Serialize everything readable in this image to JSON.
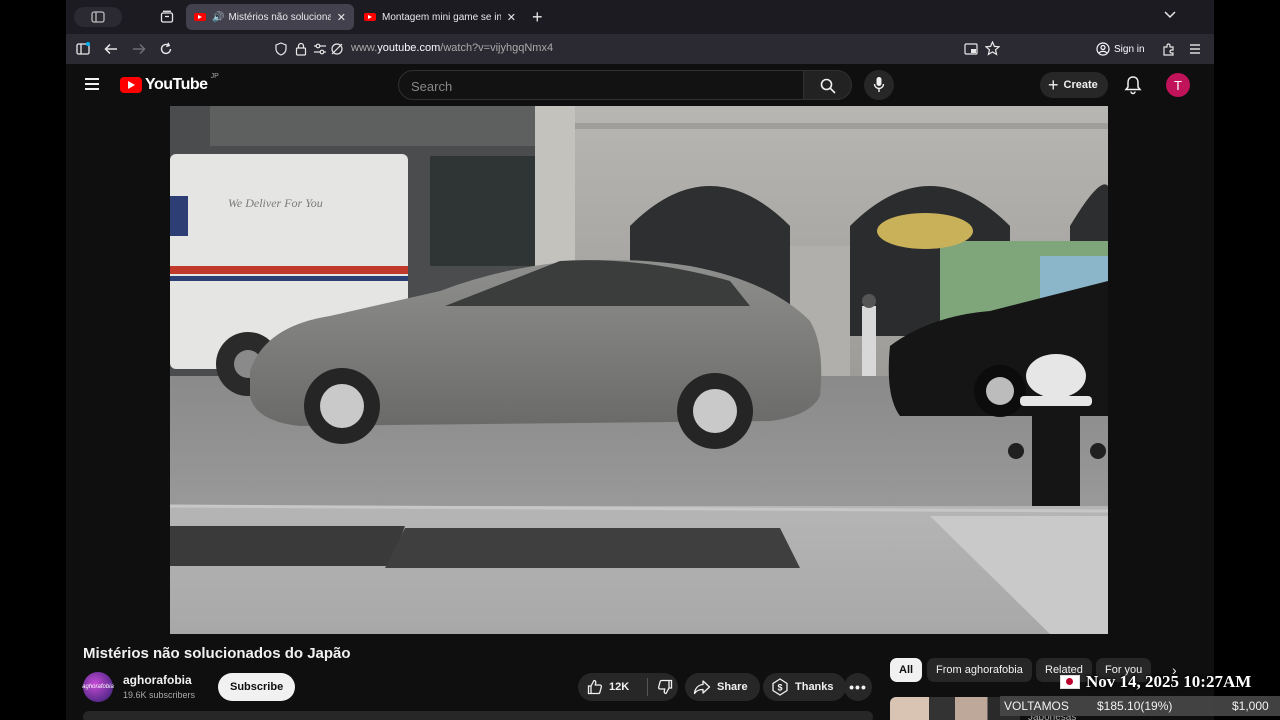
{
  "browser": {
    "tabs": [
      {
        "title": "Mistérios não solucionados",
        "active": true,
        "audio": true
      },
      {
        "title": "Montagem mini game se inscreva",
        "active": false,
        "audio": false
      }
    ],
    "url_prefix": "www.",
    "url_domain": "youtube.com",
    "url_rest": "/watch?v=vijyhgqNmx4",
    "sign_in_label": "Sign in"
  },
  "youtube": {
    "logo_text": "YouTube",
    "country_code": "JP",
    "search_placeholder": "Search",
    "create_label": "Create",
    "avatar_letter": "T",
    "brand_color": "#ff0000",
    "avatar_color": "#c0135a"
  },
  "video": {
    "title": "Mistérios não solucionados do Japão",
    "channel": {
      "name": "aghorafobia",
      "subscribers": "19.6K subscribers",
      "avatar_text": "aghorafobia"
    },
    "subscribe_label": "Subscribe",
    "likes": "12K",
    "share_label": "Share",
    "thanks_label": "Thanks",
    "truck_text": "We Deliver For You"
  },
  "sidebar": {
    "chips": [
      "All",
      "From aghorafobia",
      "Related",
      "For you"
    ],
    "selected_chip": "All",
    "first_item_sub": "Japonesas"
  },
  "overlay": {
    "timestamp": "Nov 14, 2025 10:27AM",
    "ticker_name": "VOLTAMOS",
    "ticker_change": "$185.10(19%)",
    "ticker_value": "$1,000"
  }
}
